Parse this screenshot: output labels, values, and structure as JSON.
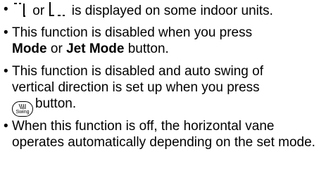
{
  "items": [
    {
      "icon1": "vane-up-position-icon",
      "or": "or",
      "icon2": "vane-down-position-icon",
      "rest": "is displayed on some indoor units."
    },
    {
      "line1": "This function is disabled when you press",
      "bold1": "Mode",
      "or": "or",
      "bold2": "Jet Mode",
      "tail": "button."
    },
    {
      "line1": "This function is disabled and auto swing of",
      "line2": "vertical direction is set up when you press",
      "button_label": "Swing",
      "tail": "button."
    },
    {
      "text": "When this function is off, the horizontal vane operates automatically depending on the set mode."
    }
  ],
  "bullet": "•"
}
